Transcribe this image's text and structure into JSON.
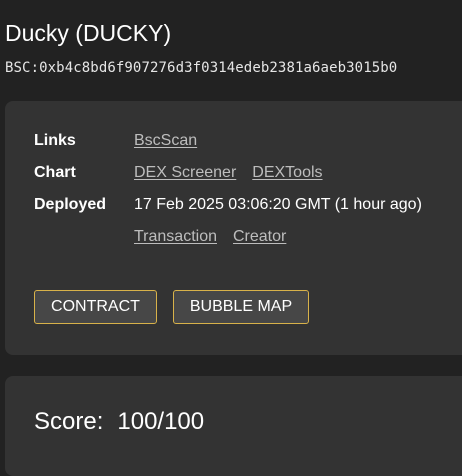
{
  "token": {
    "title": "Ducky (DUCKY)",
    "address": "BSC:0xb4c8bd6f907276d3f0314edeb2381a6aeb3015b0"
  },
  "details": {
    "links": {
      "label": "Links",
      "items": [
        "BscScan"
      ]
    },
    "chart": {
      "label": "Chart",
      "items": [
        "DEX Screener",
        "DEXTools"
      ]
    },
    "deployed": {
      "label": "Deployed",
      "value": "17 Feb 2025 03:06:20 GMT (1 hour ago)",
      "links": [
        "Transaction",
        "Creator"
      ]
    }
  },
  "buttons": {
    "contract": "CONTRACT",
    "bubble_map": "BUBBLE MAP"
  },
  "score": {
    "label": "Score:",
    "value": "100/100"
  },
  "colors": {
    "background": "#222222",
    "panel": "#333333",
    "button_border": "#d8b24a",
    "link": "#bdbdbd"
  }
}
